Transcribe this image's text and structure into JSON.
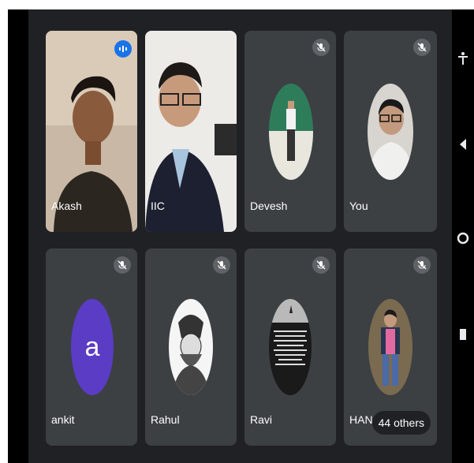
{
  "participants": [
    {
      "name": "Akash",
      "status": "speaking",
      "has_video": true
    },
    {
      "name": "IIC",
      "status": "unmuted",
      "has_video": true
    },
    {
      "name": "Devesh",
      "status": "muted",
      "has_video": false
    },
    {
      "name": "You",
      "status": "muted",
      "has_video": false
    },
    {
      "name": "ankit",
      "status": "muted",
      "has_video": false,
      "avatar_letter": "a",
      "avatar_color": "#5b3cc4"
    },
    {
      "name": "Rahul",
      "status": "muted",
      "has_video": false
    },
    {
      "name": "Ravi",
      "status": "muted",
      "has_video": false
    },
    {
      "name": "HANAN",
      "status": "muted",
      "has_video": false
    }
  ],
  "others_label": "44 others",
  "colors": {
    "background": "#202124",
    "tile": "#3c4043",
    "accent": "#1a73e8",
    "avatar_ankit": "#5b3cc4"
  },
  "icons": [
    "mic-off-icon",
    "speaking-indicator-icon",
    "accessibility-icon",
    "back-icon",
    "home-icon",
    "recents-icon"
  ]
}
